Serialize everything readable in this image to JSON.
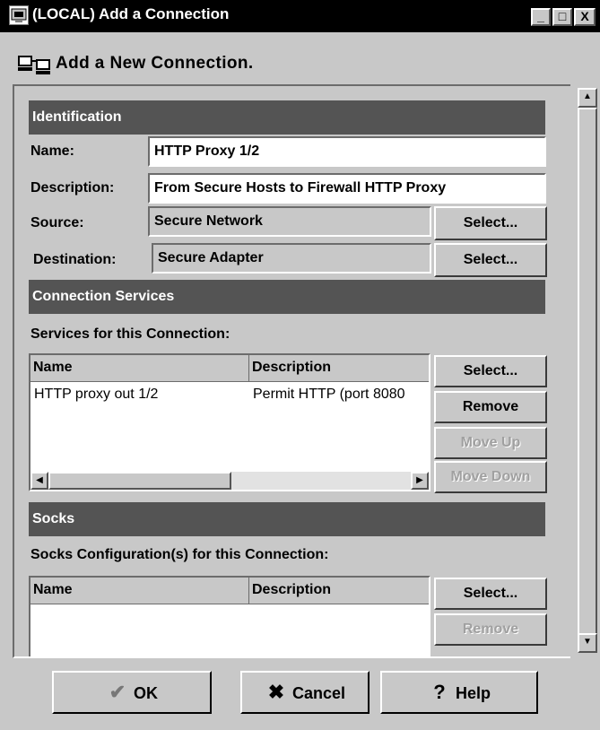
{
  "window": {
    "title": "(LOCAL) Add a Connection",
    "controls": {
      "minimize": "_",
      "maximize": "□",
      "close": "X"
    }
  },
  "header": {
    "text": "Add a New Connection."
  },
  "identification": {
    "heading": "Identification",
    "name_label": "Name:",
    "name_value": "HTTP Proxy 1/2",
    "description_label": "Description:",
    "description_value": "From Secure Hosts to Firewall HTTP Proxy",
    "source_label": "Source:",
    "source_value": "Secure Network",
    "destination_label": "Destination:",
    "destination_value": "Secure Adapter",
    "select_label": "Select..."
  },
  "services": {
    "heading": "Connection Services",
    "subheading": "Services for this Connection:",
    "columns": [
      "Name",
      "Description"
    ],
    "rows": [
      {
        "name": "HTTP proxy out 1/2",
        "description": "Permit HTTP (port 8080"
      }
    ],
    "buttons": {
      "select": "Select...",
      "remove": "Remove",
      "move_up": "Move Up",
      "move_down": "Move Down"
    }
  },
  "socks": {
    "heading": "Socks",
    "subheading": "Socks Configuration(s) for this Connection:",
    "columns": [
      "Name",
      "Description"
    ],
    "buttons": {
      "select": "Select...",
      "remove": "Remove"
    }
  },
  "footer": {
    "ok": "OK",
    "cancel": "Cancel",
    "help": "Help"
  },
  "icons": {
    "app": "window-icon",
    "header": "network-computers-icon",
    "ok": "checkmark-icon",
    "cancel": "x-cancel-icon",
    "help": "question-mark-icon"
  },
  "colors": {
    "section_bar": "#545454",
    "background": "#c8c8c8",
    "titlebar": "#000000"
  }
}
